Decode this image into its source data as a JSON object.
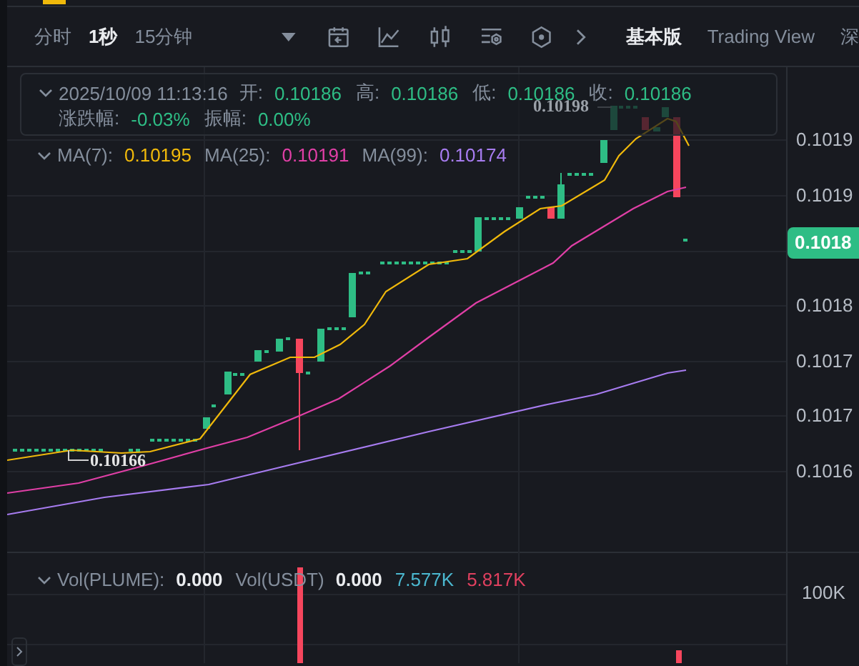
{
  "toolbar": {
    "intervals": [
      {
        "label": "分时",
        "selected": false
      },
      {
        "label": "1秒",
        "selected": true
      },
      {
        "label": "15分钟",
        "selected": false
      }
    ],
    "views": [
      {
        "label": "基本版",
        "selected": true
      },
      {
        "label": "Trading View",
        "selected": false
      },
      {
        "label": "深",
        "selected": false
      }
    ]
  },
  "ohlc": {
    "time": "2025/10/09 11:13:16",
    "row1": [
      {
        "label": "开:",
        "value": "0.10186"
      },
      {
        "label": "高:",
        "value": "0.10186"
      },
      {
        "label": "低:",
        "value": "0.10186"
      },
      {
        "label": "收:",
        "value": "0.10186"
      }
    ],
    "row2": [
      {
        "label": "涨跌幅:",
        "value": "-0.03%"
      },
      {
        "label": "振幅:",
        "value": "0.00%"
      }
    ]
  },
  "moving_averages": [
    {
      "label": "MA(7):",
      "value": "0.10195",
      "color": "#f0b90b"
    },
    {
      "label": "MA(25):",
      "value": "0.10191",
      "color": "#e03fa6"
    },
    {
      "label": "MA(99):",
      "value": "0.10174",
      "color": "#a77cf0"
    }
  ],
  "chart": {
    "high_label": "0.10198",
    "low_label": "0.10166",
    "price_axis": [
      "0.1019",
      "0.1019",
      "0.1018",
      "0.1017",
      "0.1017",
      "0.1016"
    ],
    "current_price": "0.1018"
  },
  "volume": {
    "items": [
      {
        "label": "Vol(PLUME):",
        "value": "0.000"
      },
      {
        "label": "Vol(USDT)",
        "value": "0.000"
      }
    ],
    "extra": [
      {
        "value": "7.577K",
        "color": "#4bb8d0"
      },
      {
        "value": "5.817K",
        "color": "#e0405f"
      }
    ],
    "axis": [
      "100K"
    ]
  }
}
